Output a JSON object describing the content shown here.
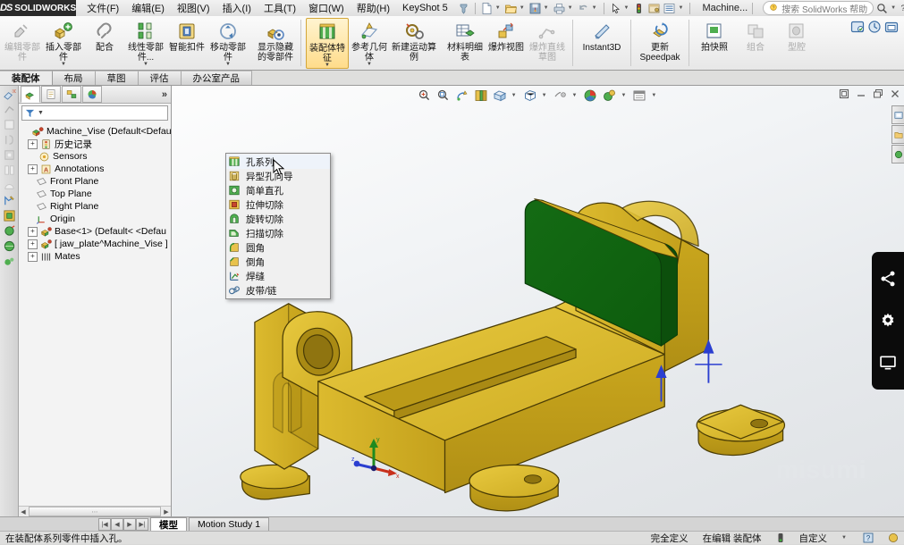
{
  "app": {
    "brand_ds": "DS",
    "brand_name": "SOLIDWORKS",
    "document_name": "Machine...",
    "help_placeholder": "搜索 SolidWorks 帮助",
    "accent": "#1f5a9e",
    "model_color": "#cfa61d",
    "highlight_color": "#0f7a20"
  },
  "menu": {
    "items": [
      {
        "label": "文件(F)"
      },
      {
        "label": "编辑(E)"
      },
      {
        "label": "视图(V)"
      },
      {
        "label": "插入(I)"
      },
      {
        "label": "工具(T)"
      },
      {
        "label": "窗口(W)"
      },
      {
        "label": "帮助(H)"
      },
      {
        "label": "KeyShot 5"
      }
    ]
  },
  "quick_access": {
    "icons": [
      "pin-icon",
      "new-document-icon",
      "open-folder-icon",
      "save-icon",
      "print-icon",
      "undo-icon",
      "select-arrow-icon",
      "rebuild-icon",
      "options-icon",
      "display-list-icon"
    ]
  },
  "ribbon": {
    "groups": [
      {
        "buttons": [
          {
            "label": "编辑零部件",
            "icon": "edit-component-icon",
            "dim": true,
            "caret": false
          },
          {
            "label": "插入零部件",
            "icon": "insert-component-icon",
            "dim": false,
            "caret": true
          },
          {
            "label": "配合",
            "icon": "mate-icon",
            "dim": false,
            "caret": false
          },
          {
            "label": "线性零部件...",
            "icon": "linear-pattern-icon",
            "dim": false,
            "caret": true
          },
          {
            "label": "智能扣件",
            "icon": "smart-fastener-icon",
            "dim": false,
            "caret": false
          },
          {
            "label": "移动零部件",
            "icon": "move-component-icon",
            "dim": false,
            "caret": true
          },
          {
            "label": "显示隐藏的零部件",
            "icon": "show-hidden-icon",
            "dim": false,
            "caret": false
          }
        ]
      },
      {
        "buttons": [
          {
            "label": "装配体特征",
            "icon": "assembly-feature-icon",
            "dim": false,
            "caret": true,
            "active": true
          },
          {
            "label": "参考几何体",
            "icon": "reference-geometry-icon",
            "dim": false,
            "caret": true
          },
          {
            "label": "新建运动算例",
            "icon": "new-motion-study-icon",
            "dim": false,
            "caret": false
          },
          {
            "label": "材料明细表",
            "icon": "bom-icon",
            "dim": false,
            "caret": false
          },
          {
            "label": "爆炸视图",
            "icon": "exploded-view-icon",
            "dim": false,
            "caret": false
          },
          {
            "label": "爆炸直线草图",
            "icon": "explode-line-sketch-icon",
            "dim": true,
            "caret": false
          }
        ]
      },
      {
        "buttons": [
          {
            "label": "Instant3D",
            "icon": "instant3d-icon",
            "dim": false,
            "caret": false
          }
        ]
      },
      {
        "buttons": [
          {
            "label": "更新 Speedpak",
            "icon": "update-speedpak-icon",
            "dim": false,
            "caret": false
          }
        ]
      },
      {
        "buttons": [
          {
            "label": "拍快照",
            "icon": "snapshot-icon",
            "dim": false,
            "caret": false
          },
          {
            "label": "组合",
            "icon": "combine-icon",
            "dim": true,
            "caret": false
          },
          {
            "label": "型腔",
            "icon": "cavity-icon",
            "dim": true,
            "caret": false
          }
        ]
      }
    ],
    "right_icons": [
      "capture-icon",
      "record-icon",
      "folder-capture-icon"
    ]
  },
  "tabs": {
    "items": [
      {
        "label": "装配体",
        "active": true
      },
      {
        "label": "布局",
        "active": false
      },
      {
        "label": "草图",
        "active": false
      },
      {
        "label": "评估",
        "active": false
      },
      {
        "label": "办公室产品",
        "active": false
      }
    ]
  },
  "flyout": {
    "name": "assembly-features-dropdown",
    "items": [
      {
        "label": "孔系列",
        "icon": "hole-series-icon",
        "highlighted": true
      },
      {
        "label": "异型孔向导",
        "icon": "hole-wizard-icon"
      },
      {
        "label": "简单直孔",
        "icon": "simple-hole-icon"
      },
      {
        "label": "拉伸切除",
        "icon": "extruded-cut-icon"
      },
      {
        "label": "旋转切除",
        "icon": "revolved-cut-icon"
      },
      {
        "label": "扫描切除",
        "icon": "swept-cut-icon"
      },
      {
        "label": "圆角",
        "icon": "fillet-icon"
      },
      {
        "label": "倒角",
        "icon": "chamfer-icon"
      },
      {
        "label": "焊缝",
        "icon": "weld-bead-icon"
      },
      {
        "label": "皮带/链",
        "icon": "belt-chain-icon"
      }
    ]
  },
  "feature_manager": {
    "tabs": [
      "feature-tree-tab",
      "property-manager-tab",
      "configuration-manager-tab",
      "display-manager-tab"
    ],
    "more_label": "»",
    "filter_placeholder": "",
    "tree": [
      {
        "label": "Machine_Vise  (Default<Defau",
        "icon": "assembly-icon",
        "indent": 0,
        "expand": "none",
        "root": true
      },
      {
        "label": "历史记录",
        "icon": "history-icon",
        "indent": 1,
        "expand": "plus"
      },
      {
        "label": "Sensors",
        "icon": "sensors-icon",
        "indent": 1,
        "expand": "none"
      },
      {
        "label": "Annotations",
        "icon": "annotations-icon",
        "indent": 1,
        "expand": "plus"
      },
      {
        "label": "Front Plane",
        "icon": "plane-icon",
        "indent": 1,
        "expand": "none"
      },
      {
        "label": "Top Plane",
        "icon": "plane-icon",
        "indent": 1,
        "expand": "none"
      },
      {
        "label": "Right Plane",
        "icon": "plane-icon",
        "indent": 1,
        "expand": "none"
      },
      {
        "label": "Origin",
        "icon": "origin-icon",
        "indent": 1,
        "expand": "none"
      },
      {
        "label": "Base<1>  (Default< <Defau",
        "icon": "part-icon",
        "indent": 1,
        "expand": "plus"
      },
      {
        "label": "[ jaw_plate^Machine_Vise ]",
        "icon": "part-icon",
        "indent": 1,
        "expand": "plus"
      },
      {
        "label": "Mates",
        "icon": "mates-folder-icon",
        "indent": 1,
        "expand": "plus"
      }
    ]
  },
  "graphics": {
    "view_toolbar_icons": [
      "zoom-to-fit-icon",
      "zoom-area-icon",
      "previous-view-icon",
      "section-view-icon",
      "view-orientation-icon",
      "display-style-icon",
      "hide-show-icon",
      "apply-scene-icon",
      "view-settings-icon",
      "appearance-icon"
    ],
    "window_buttons": [
      "restore-icon",
      "minimize-icon",
      "maximize-icon",
      "close-icon"
    ],
    "right_tabs": [
      "design-library-tab",
      "file-explorer-tab",
      "appearances-tab"
    ],
    "watermark": "misumi",
    "triad": {
      "x_label": "x",
      "y_label": "y",
      "z_label": "z"
    },
    "side_panel_icons": [
      "share-icon",
      "gear-icon",
      "monitor-icon"
    ]
  },
  "bottom": {
    "nav_buttons": [
      "first-icon",
      "prev-icon",
      "next-icon",
      "last-icon"
    ],
    "tabs": [
      {
        "label": "模型",
        "active": true
      },
      {
        "label": "Motion Study 1",
        "active": false
      }
    ]
  },
  "status": {
    "message": "在装配体系列零件中插入孔。",
    "state": "完全定义",
    "editing": "在编辑 装配体",
    "custom": "自定义",
    "help_glyph": "?"
  }
}
